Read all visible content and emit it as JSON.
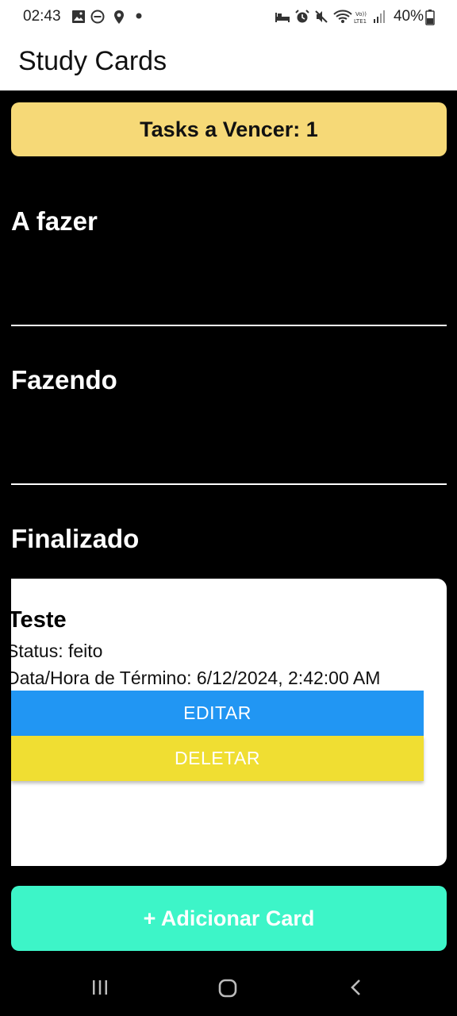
{
  "status_bar": {
    "time": "02:43",
    "battery": "40%",
    "left_icons": [
      "image-icon",
      "do-not-disturb-icon",
      "location-icon",
      "dot-icon"
    ],
    "right_icons": [
      "bed-icon",
      "alarm-icon",
      "mute-icon",
      "wifi-icon",
      "volte-icon",
      "signal-icon",
      "battery-icon"
    ]
  },
  "appbar": {
    "title": "Study Cards"
  },
  "banner": {
    "text": "Tasks a Vencer: 1",
    "color": "#f6d977"
  },
  "sections": {
    "todo": {
      "title": "A fazer"
    },
    "doing": {
      "title": "Fazendo"
    },
    "done": {
      "title": "Finalizado"
    }
  },
  "card": {
    "title": "Teste",
    "status": "Status: feito",
    "due": "Data/Hora de Término: 6/12/2024, 2:42:00 AM",
    "edit_label": "EDITAR",
    "delete_label": "DELETAR",
    "edit_color": "#2196f3",
    "delete_color": "#f0de32"
  },
  "add_button": {
    "label": "+ Adicionar Card",
    "color": "#3df5c8"
  },
  "navbar": {
    "icons": [
      "recents-icon",
      "home-icon",
      "back-icon"
    ]
  }
}
